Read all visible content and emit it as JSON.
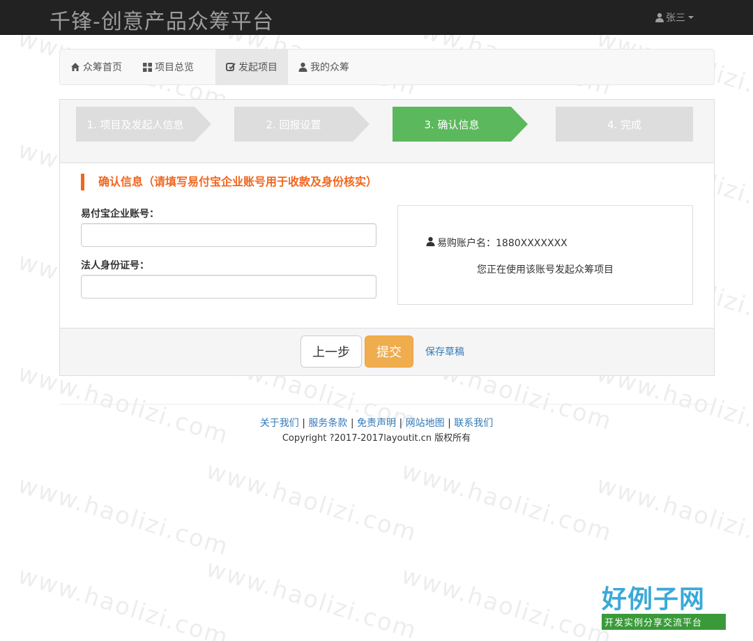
{
  "header": {
    "brand": "千锋-创意产品众筹平台",
    "user_name": "张三"
  },
  "nav": {
    "items": [
      {
        "label": "众筹首页",
        "icon": "home-icon"
      },
      {
        "label": "项目总览",
        "icon": "grid-icon"
      },
      {
        "label": "发起项目",
        "icon": "edit-icon",
        "active": true
      },
      {
        "label": "我的众筹",
        "icon": "user-icon"
      }
    ]
  },
  "steps": [
    {
      "label": "1. 项目及发起人信息"
    },
    {
      "label": "2. 回报设置"
    },
    {
      "label": "3. 确认信息",
      "current": true
    },
    {
      "label": "4. 完成"
    }
  ],
  "form": {
    "section_title": "确认信息（请填写易付宝企业账号用于收款及身份核实）",
    "account_label": "易付宝企业账号：",
    "account_value": "",
    "id_label": "法人身份证号：",
    "id_value": ""
  },
  "info": {
    "account_line": "易购账户名：1880XXXXXXX",
    "note": "您正在使用该账号发起众筹项目"
  },
  "actions": {
    "prev_label": "上一步",
    "submit_label": "提交",
    "draft_label": "保存草稿"
  },
  "footer": {
    "links": [
      "关于我们",
      "服务条款",
      "免责声明",
      "网站地图",
      "联系我们"
    ],
    "separator": " | ",
    "copyright": "Copyright ?2017-2017layoutit.cn 版权所有"
  },
  "watermark": "www.haolizi.com",
  "logo": {
    "main": "好例子网",
    "sub": "开发实例分享交流平台"
  },
  "colors": {
    "accent_orange": "#f0661e",
    "step_current": "#5cb85c",
    "step_default": "#dddddd",
    "submit": "#f0ad4e",
    "link": "#337ab7"
  }
}
